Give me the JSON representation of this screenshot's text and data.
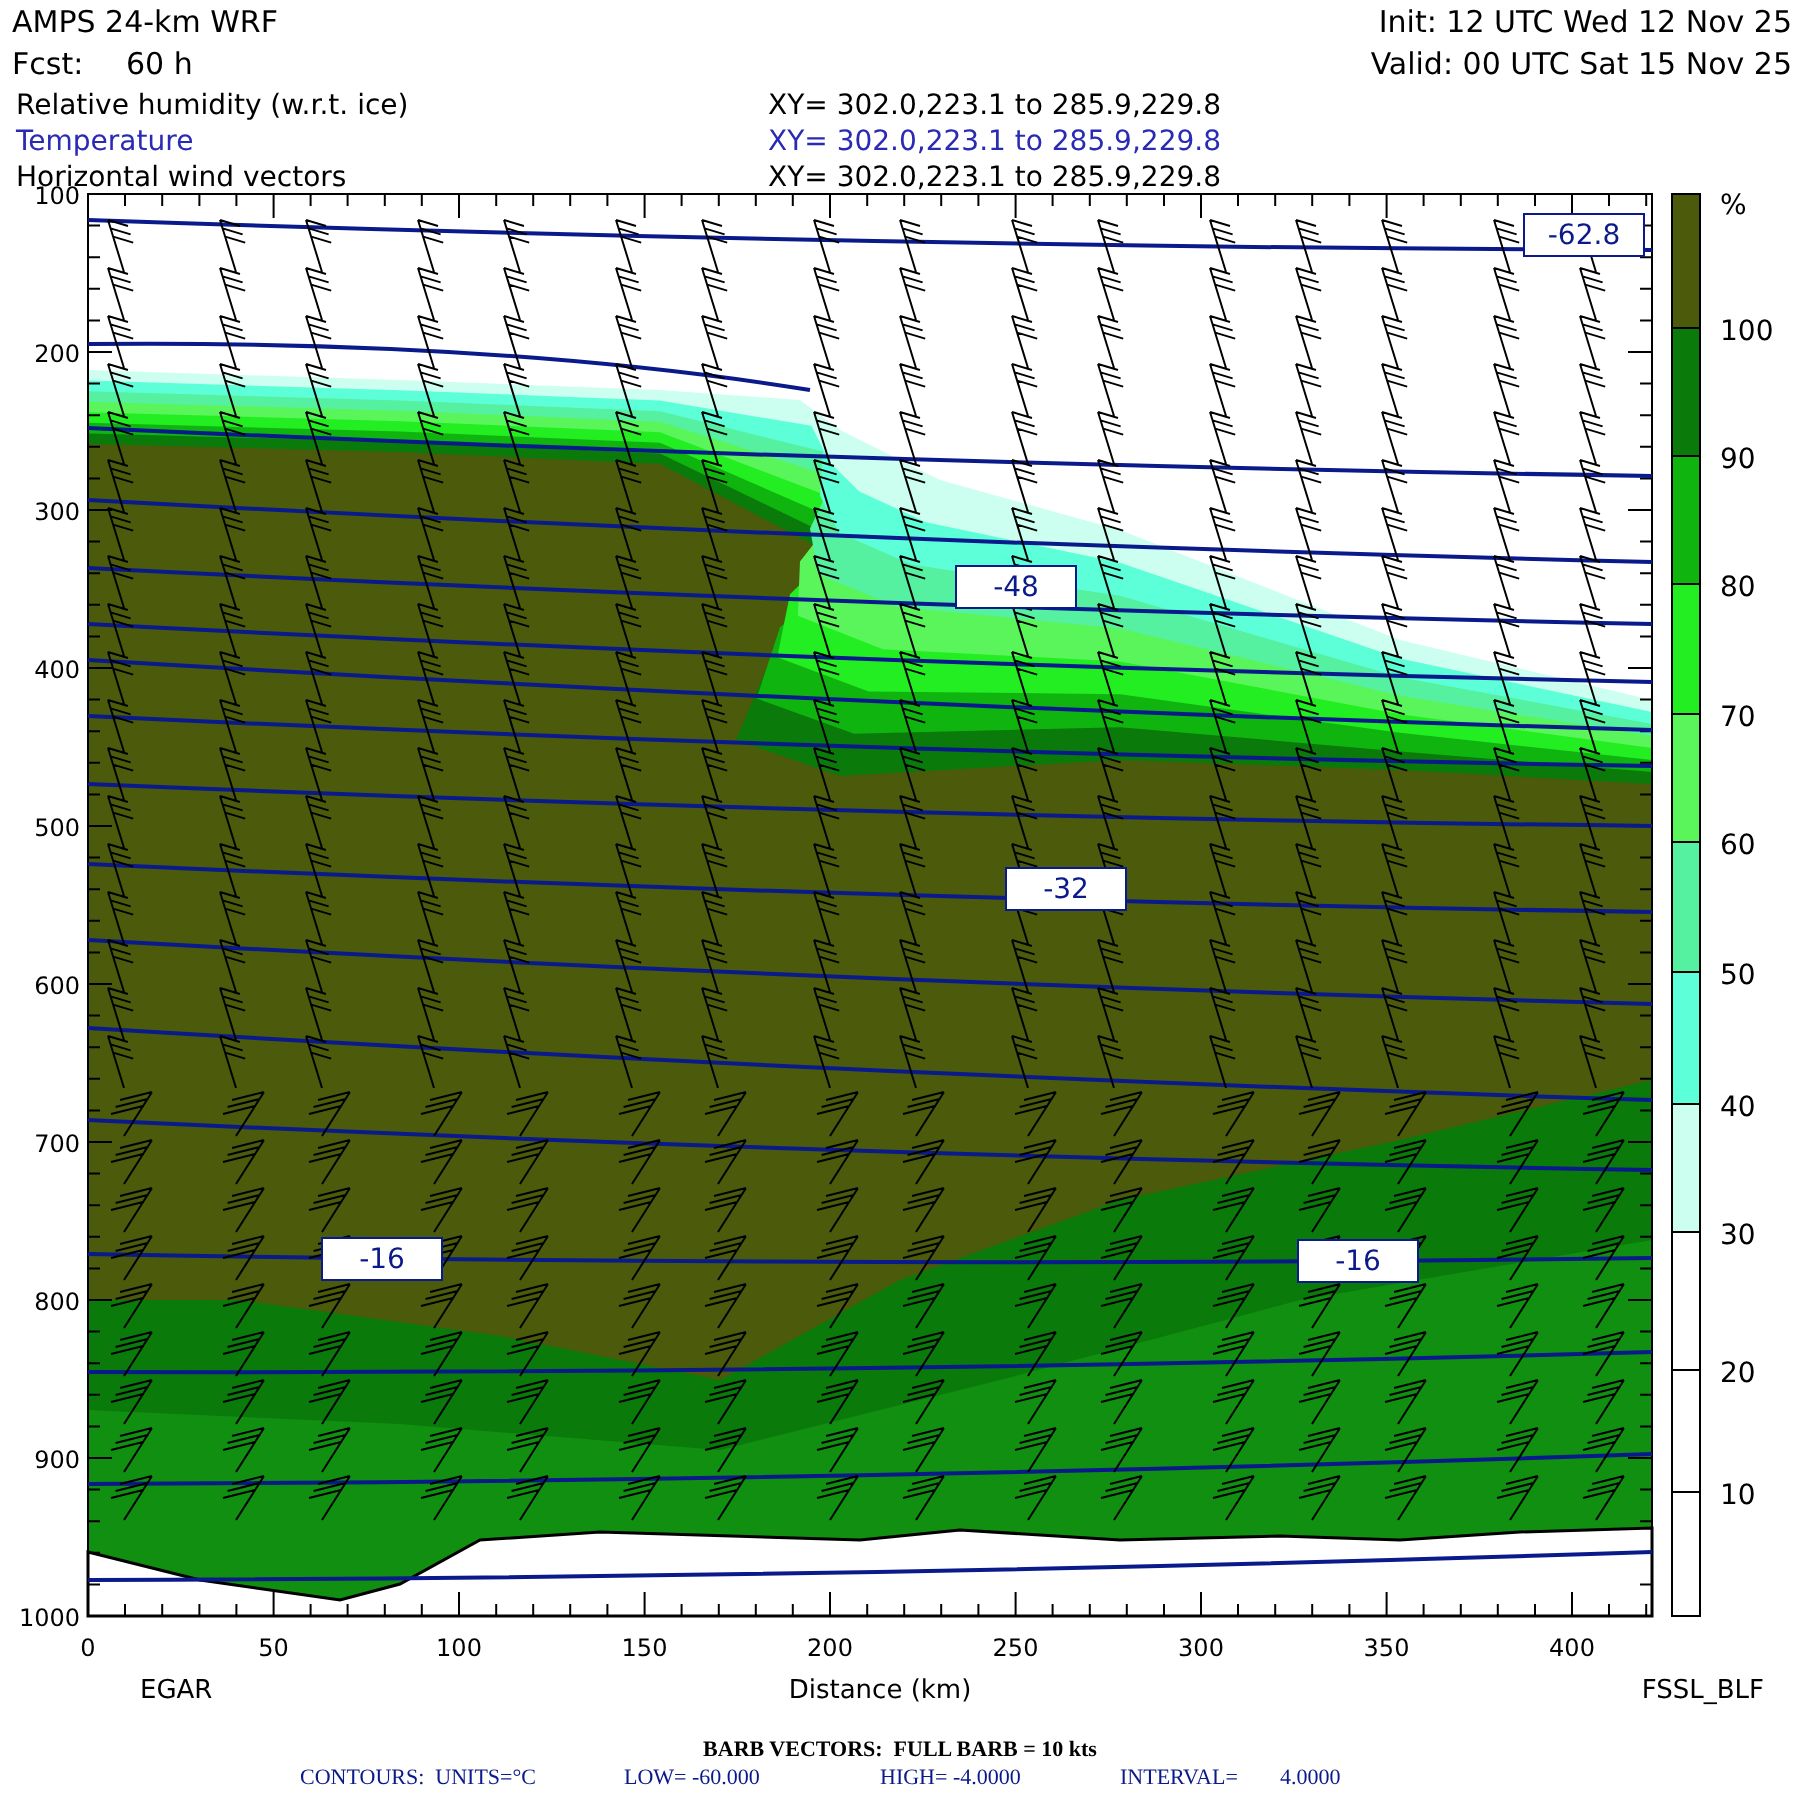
{
  "header": {
    "model": "AMPS 24-km WRF",
    "forecast_label": "Fcst:",
    "forecast_hours": "60 h",
    "init": "Init: 12 UTC Wed 12 Nov 25",
    "valid": "Valid: 00 UTC Sat 15 Nov 25"
  },
  "fields": [
    {
      "name": "Relative humidity (w.r.t. ice)",
      "range": "XY= 302.0,223.1 to 285.9,229.8",
      "color": "#000000"
    },
    {
      "name": "Temperature",
      "range": "XY= 302.0,223.1 to 285.9,229.8",
      "color": "#2a2ab4"
    },
    {
      "name": "Horizontal wind vectors",
      "range": "XY= 302.0,223.1 to 285.9,229.8",
      "color": "#000000"
    }
  ],
  "plot": {
    "y_ticks": [
      "100",
      "200",
      "300",
      "400",
      "500",
      "600",
      "700",
      "800",
      "900",
      "1000"
    ],
    "x_ticks": [
      "0",
      "50",
      "100",
      "150",
      "200",
      "250",
      "300",
      "350",
      "400"
    ],
    "xlabel": "Distance (km)",
    "start_label": "EGAR",
    "end_label": "FSSL_BLF",
    "contour_labels": [
      {
        "text": "-62.8"
      },
      {
        "text": "-48"
      },
      {
        "text": "-32"
      },
      {
        "text": "-16"
      },
      {
        "text": "-16"
      }
    ]
  },
  "colorbar": {
    "unit": "%",
    "bins": [
      {
        "color": "#4b5b0b"
      },
      {
        "color": "#0a7a0a"
      },
      {
        "color": "#0fb40f"
      },
      {
        "color": "#22ee22"
      },
      {
        "color": "#5af55a"
      },
      {
        "color": "#55f0a0"
      },
      {
        "color": "#5cffd8"
      },
      {
        "color": "#ccfff0"
      },
      {
        "color": "#ffffff"
      },
      {
        "color": "#ffffff"
      },
      {
        "color": "#ffffff"
      }
    ],
    "labels": [
      "100",
      "90",
      "80",
      "70",
      "60",
      "50",
      "40",
      "30",
      "20",
      "10"
    ]
  },
  "footer": {
    "barb_line": "BARB VECTORS:  FULL BARB = 10 kts",
    "contour_parts": [
      "CONTOURS:  UNITS=°C",
      "LOW= -60.000",
      "HIGH= -4.0000",
      "INTERVAL=",
      "4.0000"
    ]
  }
}
